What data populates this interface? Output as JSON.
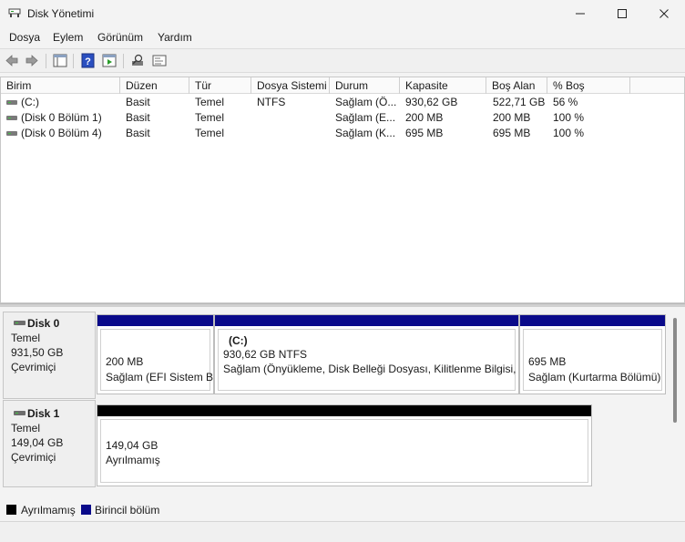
{
  "window": {
    "title": "Disk Yönetimi"
  },
  "menu": [
    "Dosya",
    "Eylem",
    "Görünüm",
    "Yardım"
  ],
  "columns": [
    "Birim",
    "Düzen",
    "Tür",
    "Dosya Sistemi",
    "Durum",
    "Kapasite",
    "Boş Alan",
    "% Boş"
  ],
  "rows": [
    {
      "birim": "(C:)",
      "duzen": "Basit",
      "tur": "Temel",
      "dosya_sistemi": "NTFS",
      "durum": "Sağlam (Ö...",
      "kapasite": "930,62 GB",
      "bos_alan": "522,71 GB",
      "yuzde_bos": "56 %"
    },
    {
      "birim": "(Disk 0 Bölüm 1)",
      "duzen": "Basit",
      "tur": "Temel",
      "dosya_sistemi": "",
      "durum": "Sağlam (E...",
      "kapasite": "200 MB",
      "bos_alan": "200 MB",
      "yuzde_bos": "100 %"
    },
    {
      "birim": "(Disk 0 Bölüm 4)",
      "duzen": "Basit",
      "tur": "Temel",
      "dosya_sistemi": "",
      "durum": "Sağlam (K...",
      "kapasite": "695 MB",
      "bos_alan": "695 MB",
      "yuzde_bos": "100 %"
    }
  ],
  "disks": [
    {
      "name": "Disk 0",
      "type": "Temel",
      "size": "931,50 GB",
      "status": "Çevrimiçi",
      "partitions": [
        {
          "title": "",
          "size": "200 MB",
          "status": "Sağlam (EFI Sistem Bö"
        },
        {
          "title": "(C:)",
          "size": "930,62 GB NTFS",
          "status": "Sağlam (Önyükleme, Disk Belleği Dosyası, Kilitlenme Bilgisi, T"
        },
        {
          "title": "",
          "size": "695 MB",
          "status": "Sağlam (Kurtarma Bölümü)"
        }
      ]
    },
    {
      "name": "Disk 1",
      "type": "Temel",
      "size": "149,04 GB",
      "status": "Çevrimiçi",
      "partitions": [
        {
          "title": "",
          "size": "149,04 GB",
          "status": "Ayrılmamış"
        }
      ]
    }
  ],
  "legend": [
    {
      "label": "Ayrılmamış",
      "color": "#000000"
    },
    {
      "label": "Birincil bölüm",
      "color": "#0a0a8a"
    }
  ],
  "colors": {
    "primary_partition": "#0a0a8a",
    "unallocated": "#000000"
  }
}
